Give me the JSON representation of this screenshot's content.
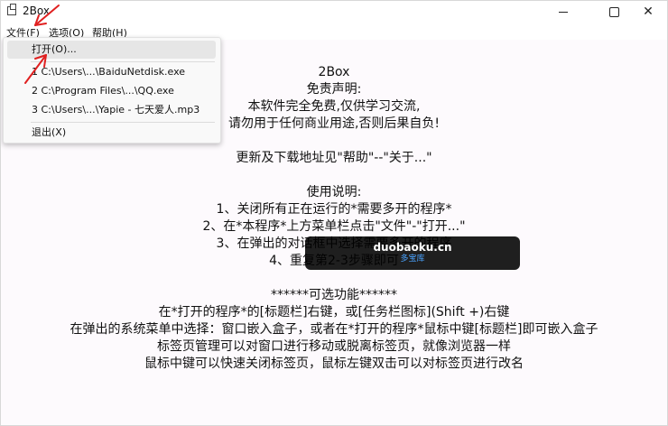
{
  "window": {
    "title": "2Box",
    "icon": "app-window-icon",
    "controls": [
      "minimize",
      "maximize",
      "close"
    ]
  },
  "menubar": {
    "items": [
      {
        "label": "文件(F)"
      },
      {
        "label": "选项(O)"
      },
      {
        "label": "帮助(H)"
      }
    ]
  },
  "file_menu": {
    "items": [
      {
        "label": "打开(O)..."
      },
      {
        "label": "1 C:\\Users\\...\\BaiduNetdisk.exe"
      },
      {
        "label": "2 C:\\Program Files\\...\\QQ.exe"
      },
      {
        "label": "3 C:\\Users\\...\\Yapie - 七天爱人.mp3"
      },
      {
        "label": "退出(X)"
      }
    ]
  },
  "content": {
    "lines": [
      "2Box",
      "免责声明:",
      "本软件完全免费,仅供学习交流,",
      "请勿用于任何商业用途,否则后果自负!",
      "",
      "更新及下载地址见\"帮助\"--\"关于...\"",
      "",
      "使用说明:",
      "1、关闭所有正在运行的*需要多开的程序*",
      "2、在*本程序*上方菜单栏点击\"文件\"-\"打开...\"",
      "3、在弹出的对话框中选择需要多开的程序",
      "4、重复第2-3步骤即可",
      "",
      "******可选功能******",
      "在*打开的程序*的[标题栏]右键，或[任务栏图标](Shift +)右键",
      "在弹出的系统菜单中选择：窗口嵌入盒子，或者在*打开的程序*鼠标中键[标题栏]即可嵌入盒子",
      "标签页管理可以对窗口进行移动或脱离标签页，就像浏览器一样",
      "鼠标中键可以快速关闭标签页，鼠标左键双击可以对标签页进行改名"
    ]
  },
  "watermark": {
    "title": "duobaoku.cn",
    "subtitle": "多宝库"
  },
  "colors": {
    "content_bg": "#fdfafd",
    "annotation_arrow": "#e02020",
    "watermark_bg": "#000000",
    "watermark_sub": "#4aa3ff"
  }
}
